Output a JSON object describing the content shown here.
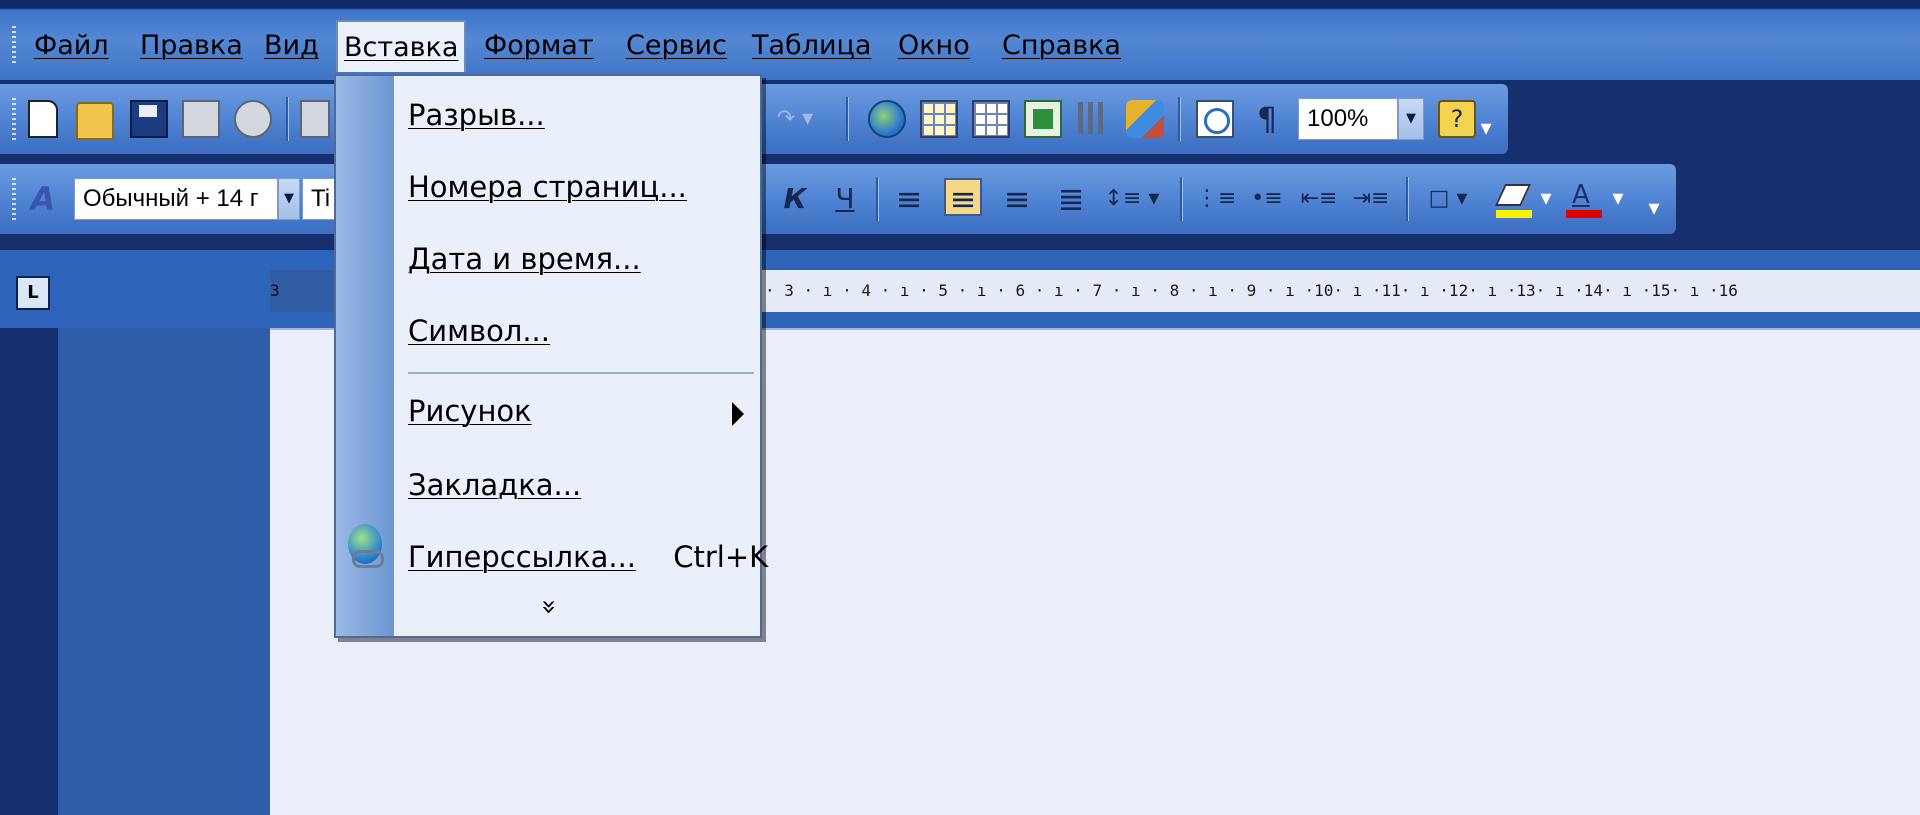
{
  "menubar": {
    "items": [
      {
        "label": "Файл"
      },
      {
        "label": "Правка"
      },
      {
        "label": "Вид"
      },
      {
        "label": "Вставка",
        "active": true
      },
      {
        "label": "Формат"
      },
      {
        "label": "Сервис"
      },
      {
        "label": "Таблица"
      },
      {
        "label": "Окно"
      },
      {
        "label": "Справка"
      }
    ]
  },
  "standard_toolbar": {
    "icons": [
      "new-document-icon",
      "open-folder-icon",
      "save-icon",
      "permission-icon",
      "print-preview-icon",
      "print-icon",
      "redo-icon",
      "insert-hyperlink-icon",
      "tables-borders-icon",
      "insert-table-icon",
      "insert-excel-icon",
      "columns-icon",
      "drawing-icon",
      "document-map-icon",
      "show-formatting-icon",
      "help-icon"
    ],
    "zoom": "100%"
  },
  "formatting_toolbar": {
    "style": "Обычный + 14 г",
    "font": "Ti",
    "italic_glyph": "К",
    "underline_glyph": "Ч",
    "icons": [
      "styles-icon",
      "italic-icon",
      "underline-icon",
      "align-left-icon",
      "align-center-icon",
      "align-right-icon",
      "justify-icon",
      "line-spacing-icon",
      "numbering-icon",
      "bullets-icon",
      "decrease-indent-icon",
      "increase-indent-icon",
      "borders-icon",
      "highlight-icon",
      "font-color-icon"
    ]
  },
  "ruler": {
    "tab_selector": "L",
    "left_fragment": "3",
    "scale": "· 3 · ı · 4 · ı · 5 · ı · 6 · ı · 7 · ı · 8 · ı · 9 · ı ·10· ı ·11· ı ·12· ı ·13· ı ·14· ı ·15· ı ·16"
  },
  "insert_menu": {
    "items": [
      {
        "label": "Разрыв...",
        "shortcut": ""
      },
      {
        "label": "Номера страниц...",
        "shortcut": ""
      },
      {
        "label": "Дата и время...",
        "shortcut": ""
      },
      {
        "label": "Символ...",
        "shortcut": ""
      },
      {
        "label": "Рисунок",
        "shortcut": "",
        "submenu": true
      },
      {
        "label": "Закладка...",
        "shortcut": ""
      },
      {
        "label": "Гиперссылка...",
        "shortcut": "Ctrl+K",
        "icon": "hyperlink-icon"
      }
    ],
    "expand_glyph": "»"
  },
  "colors": {
    "menubar": "#4a80d0",
    "menu_background": "#eaf0fa",
    "menu_gutter": "#7fa4dc",
    "document_page": "#e9eef8"
  }
}
